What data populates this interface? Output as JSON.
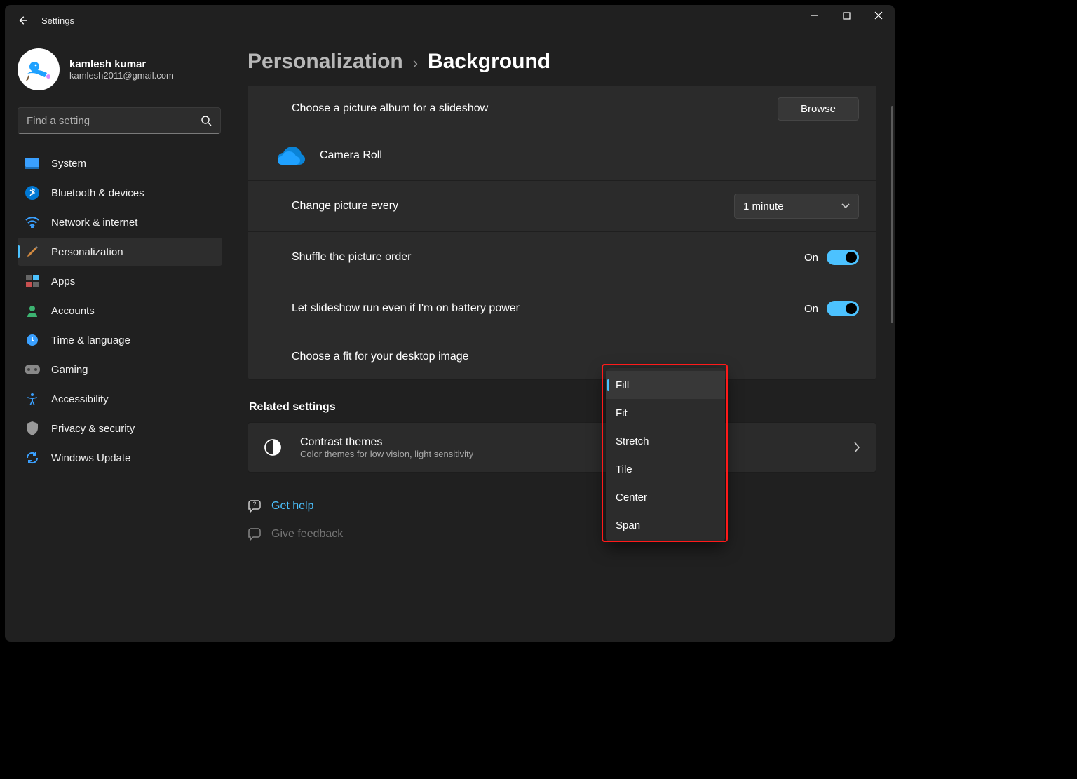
{
  "titlebar": {
    "app_name": "Settings"
  },
  "profile": {
    "name": "kamlesh kumar",
    "email": "kamlesh2011@gmail.com"
  },
  "search": {
    "placeholder": "Find a setting"
  },
  "nav": [
    {
      "label": "System"
    },
    {
      "label": "Bluetooth & devices"
    },
    {
      "label": "Network & internet"
    },
    {
      "label": "Personalization"
    },
    {
      "label": "Apps"
    },
    {
      "label": "Accounts"
    },
    {
      "label": "Time & language"
    },
    {
      "label": "Gaming"
    },
    {
      "label": "Accessibility"
    },
    {
      "label": "Privacy & security"
    },
    {
      "label": "Windows Update"
    }
  ],
  "breadcrumb": {
    "parent": "Personalization",
    "separator": "›",
    "current": "Background"
  },
  "panel": {
    "album_label": "Choose a picture album for a slideshow",
    "browse": "Browse",
    "album_name": "Camera Roll",
    "interval_label": "Change picture every",
    "interval_value": "1 minute",
    "shuffle_label": "Shuffle the picture order",
    "shuffle_state": "On",
    "battery_label": "Let slideshow run even if I'm on battery power",
    "battery_state": "On",
    "fit_label": "Choose a fit for your desktop image"
  },
  "related": {
    "heading": "Related settings",
    "contrast_title": "Contrast themes",
    "contrast_sub": "Color themes for low vision, light sensitivity"
  },
  "links": {
    "get_help": "Get help",
    "feedback": "Give feedback"
  },
  "dropdown": [
    "Fill",
    "Fit",
    "Stretch",
    "Tile",
    "Center",
    "Span"
  ]
}
